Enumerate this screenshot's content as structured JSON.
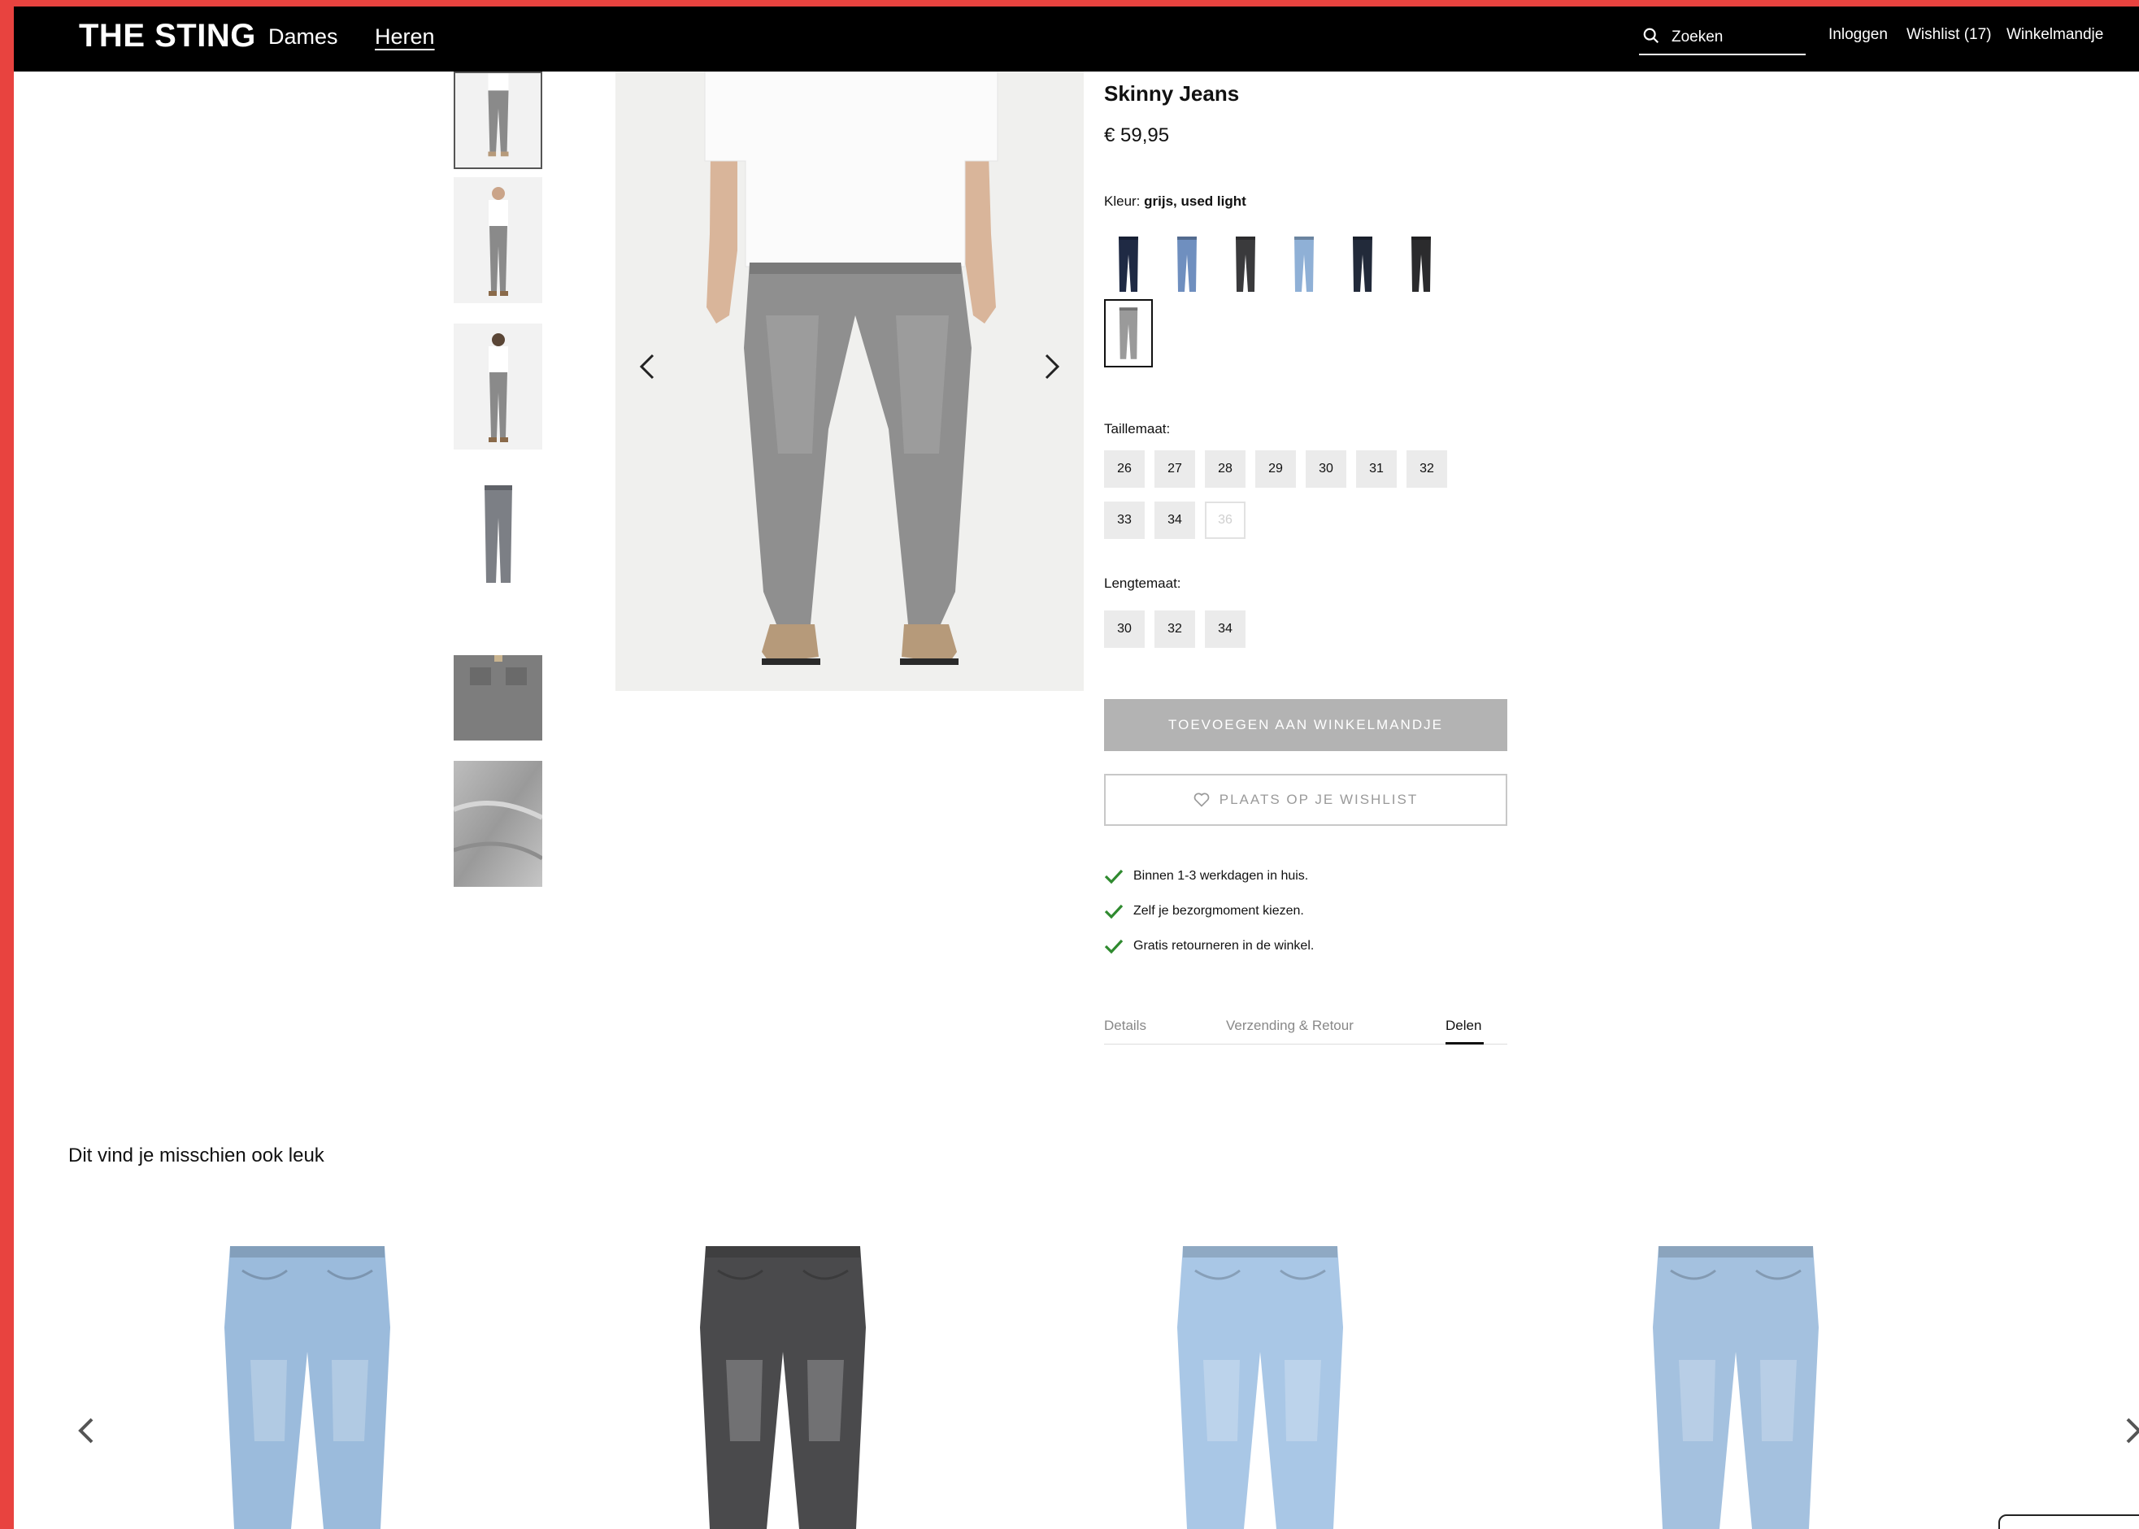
{
  "header": {
    "logo": "THE STING",
    "nav": [
      {
        "label": "Dames"
      },
      {
        "label": "Heren"
      }
    ],
    "search_placeholder": "Zoeken",
    "links": {
      "login": "Inloggen",
      "wishlist": "Wishlist (17)",
      "cart": "Winkelmandje"
    }
  },
  "product": {
    "title": "Skinny Jeans",
    "price": "€ 59,95",
    "color_label": "Kleur:",
    "color_value": "grijs, used light",
    "colors": [
      {
        "name": "dark-navy",
        "hex": "#1f2a44"
      },
      {
        "name": "mid-blue",
        "hex": "#6f8fbf"
      },
      {
        "name": "charcoal",
        "hex": "#3a3a3c"
      },
      {
        "name": "light-blue",
        "hex": "#8fb0d6"
      },
      {
        "name": "deep-navy",
        "hex": "#222a3a"
      },
      {
        "name": "black",
        "hex": "#2b2b2d"
      },
      {
        "name": "grijs-used-light",
        "hex": "#9a9a9a",
        "selected": true
      }
    ],
    "waist_label": "Taillemaat:",
    "waist_sizes": [
      {
        "label": "26"
      },
      {
        "label": "27"
      },
      {
        "label": "28"
      },
      {
        "label": "29"
      },
      {
        "label": "30"
      },
      {
        "label": "31"
      },
      {
        "label": "32"
      },
      {
        "label": "33"
      },
      {
        "label": "34"
      },
      {
        "label": "36",
        "available": false
      }
    ],
    "length_label": "Lengtemaat:",
    "length_sizes": [
      {
        "label": "30"
      },
      {
        "label": "32"
      },
      {
        "label": "34"
      }
    ],
    "add_to_cart": "TOEVOEGEN AAN WINKELMANDJE",
    "add_to_wishlist": "PLAATS OP JE WISHLIST",
    "usps": [
      "Binnen 1-3 werkdagen in huis.",
      "Zelf je bezorgmoment kiezen.",
      "Gratis retourneren in de winkel."
    ],
    "tabs": [
      {
        "label": "Details"
      },
      {
        "label": "Verzending & Retour"
      },
      {
        "label": "Delen",
        "active": true
      }
    ]
  },
  "recommendations": {
    "title": "Dit vind je misschien ook leuk",
    "items": [
      {
        "color": "#9bbbdc"
      },
      {
        "color": "#4a4a4c"
      },
      {
        "color": "#a9c7e6"
      },
      {
        "color": "#a4c1df"
      }
    ]
  },
  "colors": {
    "accent_border": "#e8433f",
    "header_bg": "#000000",
    "check_green": "#2f8a2f"
  }
}
